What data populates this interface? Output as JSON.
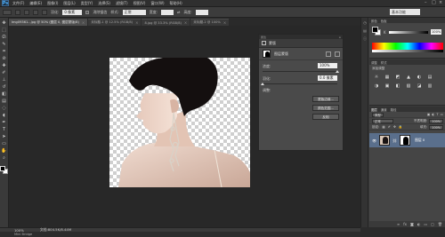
{
  "app": {
    "logo": "Ps",
    "menu": [
      "文件(F)",
      "编辑(E)",
      "图像(I)",
      "图层(L)",
      "类型(Y)",
      "选择(S)",
      "滤镜(T)",
      "视图(V)",
      "窗口(W)",
      "帮助(H)"
    ]
  },
  "options": {
    "feather_label": "羽化:",
    "feather_value": "0 像素",
    "antialias_label": "消除锯齿",
    "style_label": "样式:",
    "style_value": "正常",
    "width_label": "宽度:",
    "height_label": "高度:",
    "workspace": "基本功能"
  },
  "tabs": [
    {
      "label": "Img09361...jpg @ 50% (图层 0, 图层蒙版/8)",
      "active": true
    },
    {
      "label": "未标题-1 @ 12.5% (RGB/8)",
      "active": false
    },
    {
      "label": "8.jpg @ 33.3% (RGB/8)",
      "active": false
    },
    {
      "label": "未标题-2 @ 100%",
      "active": false
    }
  ],
  "properties": {
    "panel_title": "属性",
    "header_label": "蒙版",
    "mask_label": "图层蒙版",
    "density_label": "浓度:",
    "density_value": "100%",
    "feather_label": "羽化:",
    "feather_value": "0.0 像素",
    "refine_label": "调整:",
    "btn_edge": "蒙版边缘...",
    "btn_color": "颜色范围...",
    "btn_invert": "反相"
  },
  "color_panel": {
    "tabs": [
      "颜色",
      "色板"
    ],
    "channel": "K",
    "value": "100",
    "unit": "%"
  },
  "adjustments": {
    "tabs": [
      "调整",
      "样式"
    ],
    "subtitle": "添加调整",
    "icons": [
      "☼",
      "▦",
      "◩",
      "▲",
      "◐",
      "▤",
      "◑",
      "▣",
      "◧",
      "▧",
      "◪",
      "▥"
    ]
  },
  "layers": {
    "tabs": [
      "图层",
      "通道",
      "路径"
    ],
    "kind_label": "类型",
    "mode": "正常",
    "opacity_label": "不透明度:",
    "opacity_value": "100%",
    "lock_label": "锁定:",
    "fill_label": "填充:",
    "fill_value": "100%",
    "layer_name": "图层 0",
    "bottom_icons": [
      "∞",
      "fx",
      "◙",
      "◐",
      "▭",
      "▢",
      "🗑"
    ]
  },
  "status": {
    "zoom": "100%",
    "doc": "文档:804.5K/8.44M"
  },
  "minibridge": "Mini Bridge"
}
